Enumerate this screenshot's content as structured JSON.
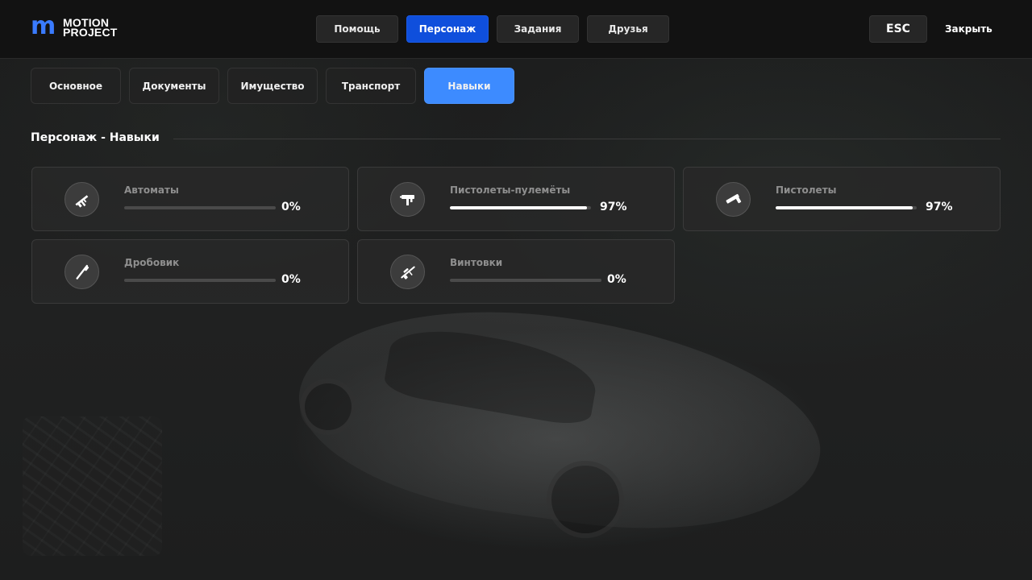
{
  "logo": {
    "icon": "m",
    "line1": "MOTION",
    "line2": "PROJECT"
  },
  "nav": [
    {
      "label": "Помощь",
      "active": false
    },
    {
      "label": "Персонаж",
      "active": true
    },
    {
      "label": "Задания",
      "active": false
    },
    {
      "label": "Друзья",
      "active": false
    }
  ],
  "esc_label": "ESC",
  "close_label": "Закрыть",
  "tabs": [
    {
      "label": "Основное",
      "active": false
    },
    {
      "label": "Документы",
      "active": false
    },
    {
      "label": "Имущество",
      "active": false
    },
    {
      "label": "Транспорт",
      "active": false
    },
    {
      "label": "Навыки",
      "active": true
    }
  ],
  "section_title": "Персонаж - Навыки",
  "skills": [
    {
      "name": "Автоматы",
      "percent_label": "0%",
      "progress": 0.0,
      "icon": "assault-rifle-icon"
    },
    {
      "name": "Пистолеты-пулемёты",
      "percent_label": "97%",
      "progress": 0.97,
      "icon": "submachine-gun-icon"
    },
    {
      "name": "Пистолеты",
      "percent_label": "97%",
      "progress": 0.97,
      "icon": "pistol-icon"
    },
    {
      "name": "Дробовик",
      "percent_label": "0%",
      "progress": 0.0,
      "icon": "shotgun-icon"
    },
    {
      "name": "Винтовки",
      "percent_label": "0%",
      "progress": 0.0,
      "icon": "sniper-rifle-icon"
    }
  ],
  "colors": {
    "accent_blue": "#0f4fdc",
    "tab_active": "#3d8bff",
    "logo_blue": "#3a7bff"
  }
}
